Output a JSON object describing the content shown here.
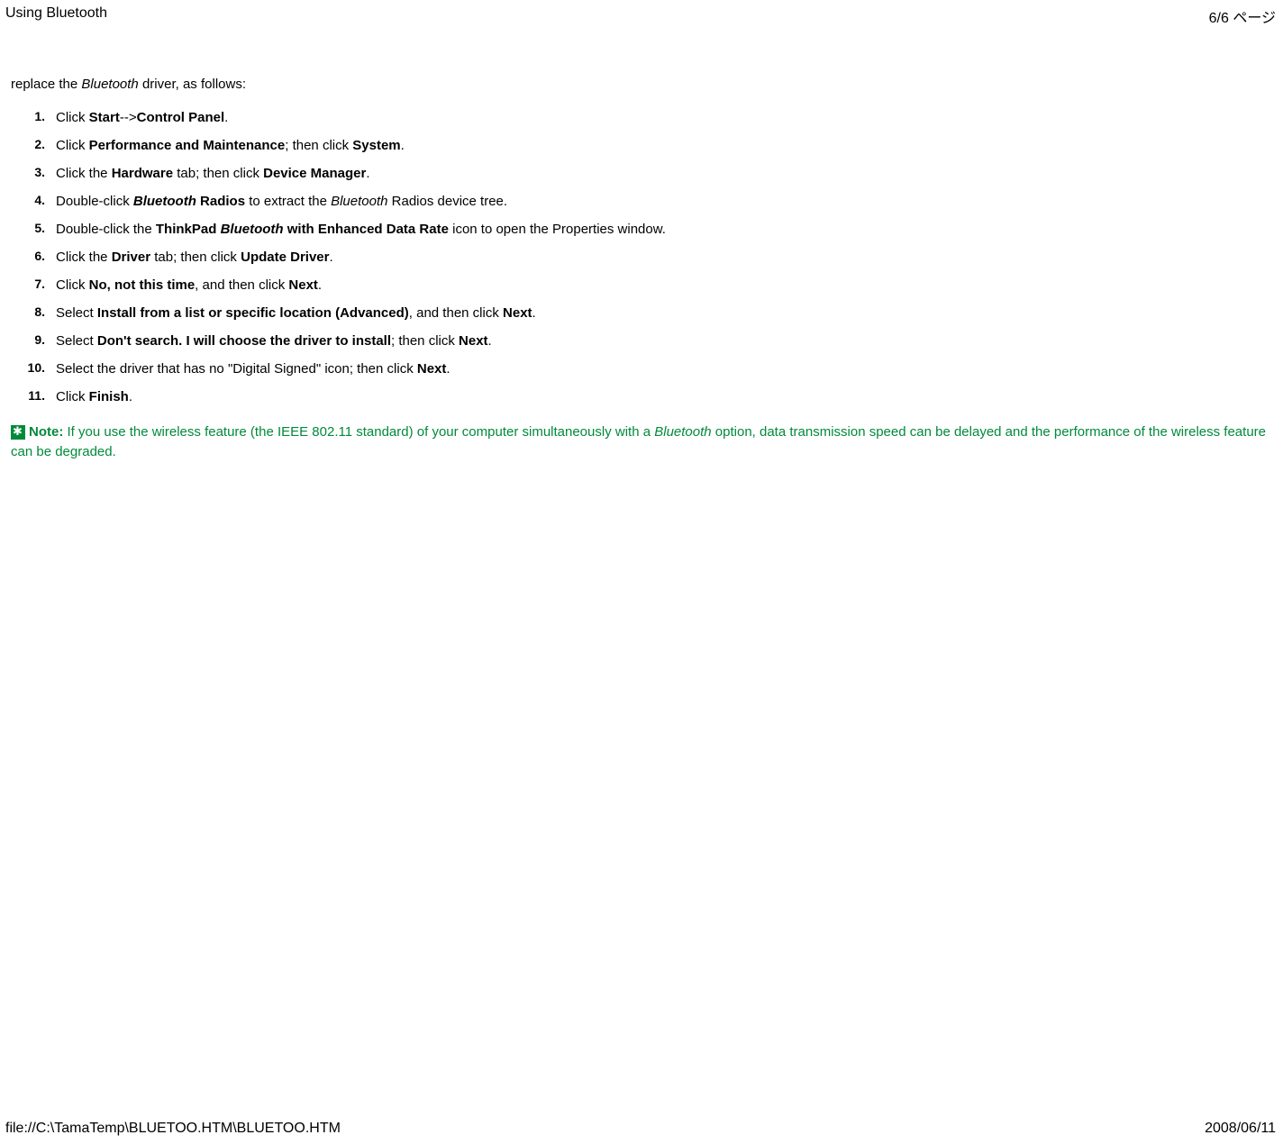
{
  "header": {
    "title_left": "Using Bluetooth",
    "title_right": "6/6 ページ"
  },
  "footer": {
    "path": "file://C:\\TamaTemp\\BLUETOO.HTM\\BLUETOO.HTM",
    "date": "2008/06/11"
  },
  "intro": {
    "pre": "replace the ",
    "italic": "Bluetooth",
    "post": " driver, as follows:"
  },
  "steps": [
    {
      "num": "1.",
      "parts": [
        {
          "t": "Click "
        },
        {
          "t": "Start",
          "b": true
        },
        {
          "t": "-->"
        },
        {
          "t": "Control Panel",
          "b": true
        },
        {
          "t": "."
        }
      ]
    },
    {
      "num": "2.",
      "parts": [
        {
          "t": "Click "
        },
        {
          "t": "Performance and Maintenance",
          "b": true
        },
        {
          "t": "; then click "
        },
        {
          "t": "System",
          "b": true
        },
        {
          "t": "."
        }
      ]
    },
    {
      "num": "3.",
      "parts": [
        {
          "t": "Click the "
        },
        {
          "t": "Hardware",
          "b": true
        },
        {
          "t": " tab; then click "
        },
        {
          "t": "Device Manager",
          "b": true
        },
        {
          "t": "."
        }
      ]
    },
    {
      "num": "4.",
      "parts": [
        {
          "t": "Double-click "
        },
        {
          "t": "Bluetooth",
          "b": true,
          "i": true
        },
        {
          "t": " Radios",
          "b": true
        },
        {
          "t": " to extract the "
        },
        {
          "t": "Bluetooth",
          "i": true
        },
        {
          "t": " Radios device tree."
        }
      ]
    },
    {
      "num": "5.",
      "parts": [
        {
          "t": "Double-click the "
        },
        {
          "t": "ThinkPad ",
          "b": true
        },
        {
          "t": "Bluetooth",
          "b": true,
          "i": true
        },
        {
          "t": " with Enhanced Data Rate",
          "b": true
        },
        {
          "t": " icon to open the Properties window."
        }
      ]
    },
    {
      "num": "6.",
      "parts": [
        {
          "t": "Click the "
        },
        {
          "t": "Driver",
          "b": true
        },
        {
          "t": " tab; then click "
        },
        {
          "t": "Update Driver",
          "b": true
        },
        {
          "t": "."
        }
      ]
    },
    {
      "num": "7.",
      "parts": [
        {
          "t": "Click "
        },
        {
          "t": "No, not this time",
          "b": true
        },
        {
          "t": ", and then click "
        },
        {
          "t": "Next",
          "b": true
        },
        {
          "t": "."
        }
      ]
    },
    {
      "num": "8.",
      "parts": [
        {
          "t": "Select "
        },
        {
          "t": "Install from a list or specific location (Advanced)",
          "b": true
        },
        {
          "t": ", and then click "
        },
        {
          "t": "Next",
          "b": true
        },
        {
          "t": "."
        }
      ]
    },
    {
      "num": "9.",
      "parts": [
        {
          "t": "Select "
        },
        {
          "t": "Don't search. I will choose the driver to install",
          "b": true
        },
        {
          "t": "; then click "
        },
        {
          "t": "Next",
          "b": true
        },
        {
          "t": "."
        }
      ]
    },
    {
      "num": "10.",
      "parts": [
        {
          "t": "Select the driver that has no \"Digital Signed\" icon; then click "
        },
        {
          "t": "Next",
          "b": true
        },
        {
          "t": "."
        }
      ]
    },
    {
      "num": "11.",
      "parts": [
        {
          "t": "Click "
        },
        {
          "t": "Finish",
          "b": true
        },
        {
          "t": "."
        }
      ]
    }
  ],
  "note": {
    "label": "Note:",
    "pre": " If you use the wireless feature (the IEEE 802.11 standard) of your computer simultaneously with a ",
    "italic": "Bluetooth",
    "post": " option, data transmission speed can be delayed and the performance of the wireless feature can be degraded."
  }
}
